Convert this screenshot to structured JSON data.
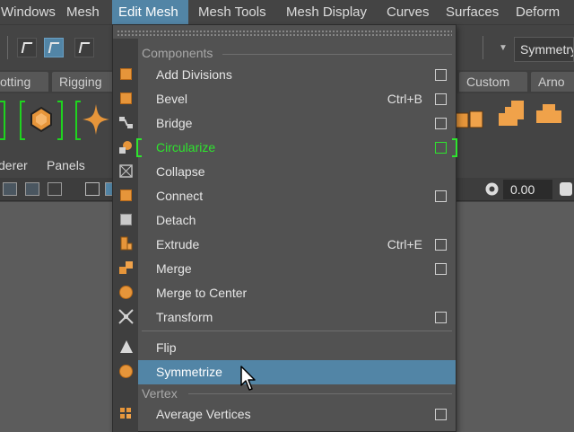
{
  "menubar": {
    "items": [
      {
        "label": "Windows",
        "active": false
      },
      {
        "label": "Mesh",
        "active": false
      },
      {
        "label": "Edit Mesh",
        "active": true
      },
      {
        "label": "Mesh Tools",
        "active": false
      },
      {
        "label": "Mesh Display",
        "active": false
      },
      {
        "label": "Curves",
        "active": false
      },
      {
        "label": "Surfaces",
        "active": false
      },
      {
        "label": "Deform",
        "active": false
      }
    ]
  },
  "toolbar": {
    "symmetry_label": "Symmetry"
  },
  "shelf": {
    "tabs": [
      "otting",
      "Rigging",
      "Custom",
      "Arno"
    ]
  },
  "panel_menu": {
    "items": [
      "derer",
      "Panels"
    ]
  },
  "panel_toolbar": {
    "value": "0.00"
  },
  "dropdown": {
    "sections": {
      "components": "Components",
      "vertex": "Vertex"
    },
    "items": [
      {
        "label": "Add Divisions",
        "shortcut": "",
        "option_box": true,
        "icon": "add-divisions-icon"
      },
      {
        "label": "Bevel",
        "shortcut": "Ctrl+B",
        "option_box": true,
        "icon": "bevel-icon"
      },
      {
        "label": "Bridge",
        "shortcut": "",
        "option_box": true,
        "icon": "bridge-icon"
      },
      {
        "label": "Circularize",
        "shortcut": "",
        "option_box": true,
        "icon": "circularize-icon"
      },
      {
        "label": "Collapse",
        "shortcut": "",
        "option_box": false,
        "icon": "collapse-icon"
      },
      {
        "label": "Connect",
        "shortcut": "",
        "option_box": true,
        "icon": "connect-icon"
      },
      {
        "label": "Detach",
        "shortcut": "",
        "option_box": false,
        "icon": "detach-icon"
      },
      {
        "label": "Extrude",
        "shortcut": "Ctrl+E",
        "option_box": true,
        "icon": "extrude-icon"
      },
      {
        "label": "Merge",
        "shortcut": "",
        "option_box": true,
        "icon": "merge-icon"
      },
      {
        "label": "Merge to Center",
        "shortcut": "",
        "option_box": false,
        "icon": "merge-to-center-icon"
      },
      {
        "label": "Transform",
        "shortcut": "",
        "option_box": true,
        "icon": "transform-icon"
      },
      {
        "label": "Flip",
        "shortcut": "",
        "option_box": false,
        "icon": "flip-icon"
      },
      {
        "label": "Symmetrize",
        "shortcut": "",
        "option_box": false,
        "icon": "symmetrize-icon"
      },
      {
        "label": "Average Vertices",
        "shortcut": "",
        "option_box": true,
        "icon": "average-vertices-icon"
      }
    ],
    "highlighted_item": "Symmetrize",
    "marked_item": "Circularize"
  },
  "colors": {
    "accent": "#5285a6",
    "marker": "#2ee52e",
    "icon_orange": "#e6953a"
  }
}
